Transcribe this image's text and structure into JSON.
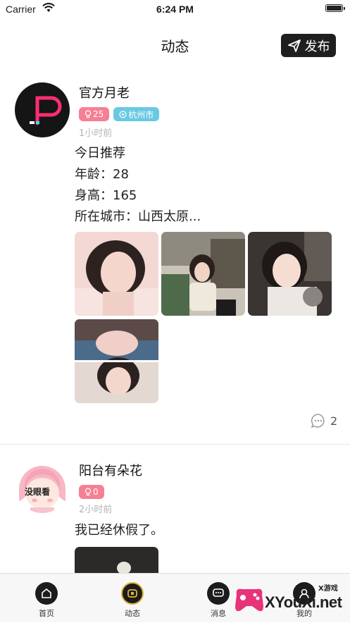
{
  "status_bar": {
    "carrier": "Carrier",
    "time": "6:24 PM"
  },
  "nav": {
    "title": "动态",
    "publish_label": "发布"
  },
  "posts": [
    {
      "username": "官方月老",
      "likes": "25",
      "city": "杭州市",
      "time": "1小时前",
      "lines": [
        "今日推荐",
        "年龄：28",
        "身高：165",
        "所在城市：山西太原..."
      ],
      "comments": "2"
    },
    {
      "username": "阳台有朵花",
      "likes": "0",
      "avatar_text": "没眼看",
      "time": "2小时前",
      "lines": [
        "我已经休假了。"
      ]
    }
  ],
  "tabs": [
    {
      "label": "首页",
      "icon": "home-icon"
    },
    {
      "label": "动态",
      "icon": "feed-icon"
    },
    {
      "label": "消息",
      "icon": "message-icon"
    },
    {
      "label": "我的",
      "icon": "profile-icon"
    }
  ],
  "watermark": {
    "text": "XYouXi.net",
    "small": "X游戏"
  },
  "colors": {
    "likes_tag": "#f67f94",
    "city_tag": "#69c9e3",
    "accent_gold": "#e0b43a"
  }
}
